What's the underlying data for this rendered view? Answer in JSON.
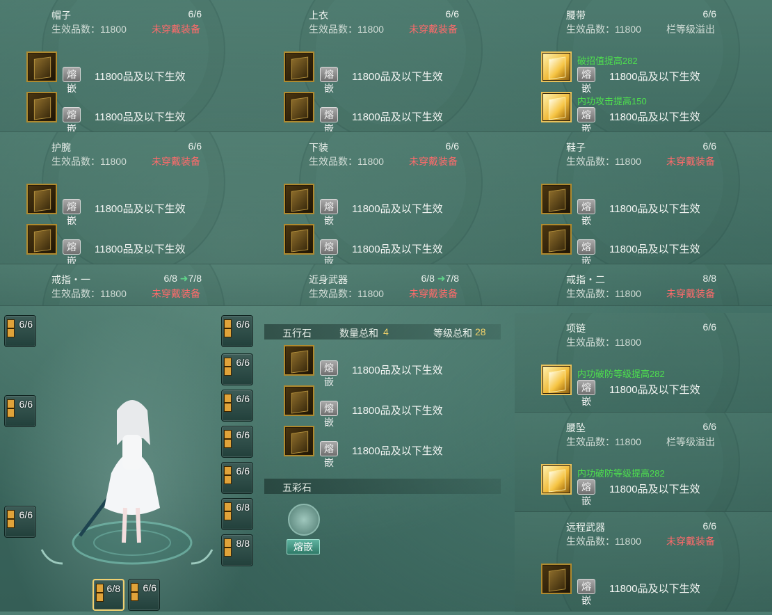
{
  "labels": {
    "effective_prefix": "生效品数：",
    "fuse": "熔嵌",
    "arrow": "➜"
  },
  "panels": [
    {
      "name": "帽子",
      "count": "6/6",
      "eff": "11800",
      "status": "未穿戴装备",
      "gems": [
        {
          "text": "11800品及以下生效"
        },
        {
          "text": "11800品及以下生效"
        }
      ]
    },
    {
      "name": "上衣",
      "count": "6/6",
      "eff": "11800",
      "status": "未穿戴装备",
      "gems": [
        {
          "text": "11800品及以下生效"
        },
        {
          "text": "11800品及以下生效"
        }
      ]
    },
    {
      "name": "腰带",
      "count": "6/6",
      "eff": "11800",
      "status": "栏等级溢出",
      "gems": [
        {
          "text": "11800品及以下生效",
          "bonus": "破招值提高282"
        },
        {
          "text": "11800品及以下生效",
          "bonus": "内功攻击提高150"
        }
      ]
    },
    {
      "name": "护腕",
      "count": "6/6",
      "eff": "11800",
      "status": "未穿戴装备",
      "gems": [
        {
          "text": "11800品及以下生效"
        },
        {
          "text": "11800品及以下生效"
        }
      ]
    },
    {
      "name": "下装",
      "count": "6/6",
      "eff": "11800",
      "status": "未穿戴装备",
      "gems": [
        {
          "text": "11800品及以下生效"
        },
        {
          "text": "11800品及以下生效"
        }
      ]
    },
    {
      "name": "鞋子",
      "count": "6/6",
      "eff": "11800",
      "status": "未穿戴装备",
      "gems": [
        {
          "text": "11800品及以下生效"
        },
        {
          "text": "11800品及以下生效"
        }
      ]
    },
    {
      "name": "戒指・一",
      "count": "6/8",
      "next": "7/8",
      "eff": "11800",
      "status": "未穿戴装备"
    },
    {
      "name": "近身武器",
      "count": "6/8",
      "next": "7/8",
      "eff": "11800",
      "status": "未穿戴装备"
    },
    {
      "name": "戒指・二",
      "count": "8/8",
      "eff": "11800",
      "status": "未穿戴装备"
    }
  ],
  "right_panels": [
    {
      "name": "项链",
      "count": "6/6",
      "eff": "11800",
      "status": "",
      "gems": [
        {
          "text": "11800品及以下生效",
          "bonus": "内功破防等级提高282"
        }
      ]
    },
    {
      "name": "腰坠",
      "count": "6/6",
      "eff": "11800",
      "status": "栏等级溢出",
      "gems": [
        {
          "text": "11800品及以下生效",
          "bonus": "内功破防等级提高282"
        }
      ]
    },
    {
      "name": "远程武器",
      "count": "6/6",
      "eff": "11800",
      "status": "未穿戴装备",
      "gems": [
        {
          "text": "11800品及以下生效"
        }
      ]
    }
  ],
  "wuxing": {
    "title": "五行石",
    "qty_label": "数量总和",
    "qty": "4",
    "lvl_label": "等级总和",
    "lvl": "28",
    "gems": [
      {
        "text": "11800品及以下生效"
      },
      {
        "text": "11800品及以下生效"
      },
      {
        "text": "11800品及以下生效"
      }
    ]
  },
  "wucai": {
    "title": "五彩石",
    "fuse": "熔嵌"
  },
  "char_slots": [
    {
      "count": "6/6"
    },
    {
      "count": "6/6"
    },
    {
      "count": "6/6"
    },
    {
      "count": "6/6"
    },
    {
      "count": "6/6"
    },
    {
      "count": "6/6"
    },
    {
      "count": "6/6"
    },
    {
      "count": "6/6"
    },
    {
      "count": "6/8"
    },
    {
      "count": "8/8"
    },
    {
      "count": "6/8"
    },
    {
      "count": "6/6"
    }
  ]
}
